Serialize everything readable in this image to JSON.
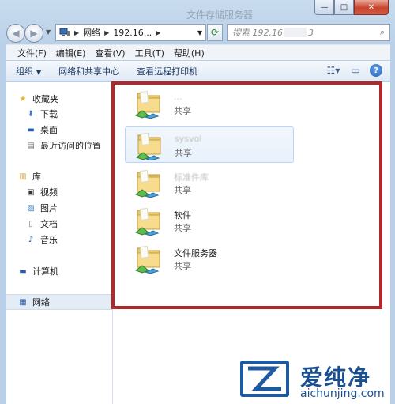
{
  "window": {
    "title": "文件存储服务器",
    "buttons": {
      "minimize": "—",
      "maximize": "□",
      "close": "✕"
    }
  },
  "nav": {
    "back_icon": "back-arrow-icon",
    "forward_icon": "forward-arrow-icon",
    "address": {
      "crumbs": [
        "网络",
        "192.16..."
      ]
    },
    "search_placeholder_start": "搜索 192.16",
    "search_placeholder_end": "3"
  },
  "menu": [
    "文件(F)",
    "编辑(E)",
    "查看(V)",
    "工具(T)",
    "帮助(H)"
  ],
  "toolbar": {
    "organize": "组织",
    "network_center": "网络和共享中心",
    "remote_printers": "查看远程打印机"
  },
  "sidebar": {
    "favorites_header": "收藏夹",
    "favorites": [
      "下载",
      "桌面",
      "最近访问的位置"
    ],
    "library_header": "库",
    "libraries": [
      "视频",
      "图片",
      "文档",
      "音乐"
    ],
    "computer": "计算机",
    "network": "网络"
  },
  "files": [
    {
      "name": "...",
      "state": "共享",
      "blurred": true
    },
    {
      "name": "sysvol",
      "state": "共享",
      "blurred": true,
      "selected": true
    },
    {
      "name": "标准件库",
      "state": "共享",
      "blurred": true
    },
    {
      "name": "软件",
      "state": "共享",
      "blurred": false
    },
    {
      "name": "文件服务器",
      "state": "共享",
      "blurred": false
    }
  ],
  "watermark": {
    "title": "爱纯净",
    "url": "aichunjing.com"
  },
  "colors": {
    "highlight": "#b0282b",
    "brand": "#1b4f8f"
  }
}
